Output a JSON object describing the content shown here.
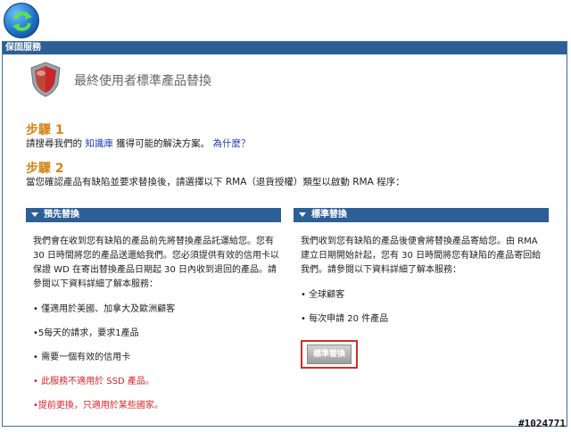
{
  "header": {
    "logo_icon": "refresh-arrows-icon"
  },
  "panel": {
    "title": "保固服務"
  },
  "hero": {
    "title": "最終使用者標準產品替換",
    "icon": "shield-icon"
  },
  "step1": {
    "title": "步驟 1",
    "text_before": "請搜尋我們的 ",
    "link_kb": "知識庫",
    "text_after": " 獲得可能的解決方案。 ",
    "link_why": "為什麼？"
  },
  "step2": {
    "title": "步驟 2",
    "text": "當您確認產品有缺陷並要求替換後，請選擇以下 RMA（退貨授權）類型以啟動 RMA 程序："
  },
  "advance": {
    "header": "預先替換",
    "paragraph": "我們會在收到您有缺陷的產品前先將替換產品託運給您。您有 30 日時間將您的產品送還給我們。您必須提供有效的信用卡以保證 WD 在寄出替換產品日期起 30 日內收到退回的產品。請參閱以下資料詳細了解本服務：",
    "bullets": [
      "• 僅適用於美國、加拿大及歐洲顧客",
      "•5每天的請求，要求1產品",
      "• 需要一個有效的信用卡"
    ],
    "red_bullets": [
      "• 此服務不適用於 SSD 產品。",
      "•提前更換，只適用於某些國家。"
    ]
  },
  "standard": {
    "header": "標準替換",
    "paragraph": "我們收到您有缺陷的產品後便會將替換產品寄給您。由 RMA 建立日期開始計起，您有 30 日時間將您有缺陷的產品寄回給我們。請參閱以下資料詳細了解本服務：",
    "bullets": [
      "• 全球顧客",
      "• 每次申請 20 件產品"
    ],
    "button": "標準替換"
  },
  "watermark": "#1024771"
}
